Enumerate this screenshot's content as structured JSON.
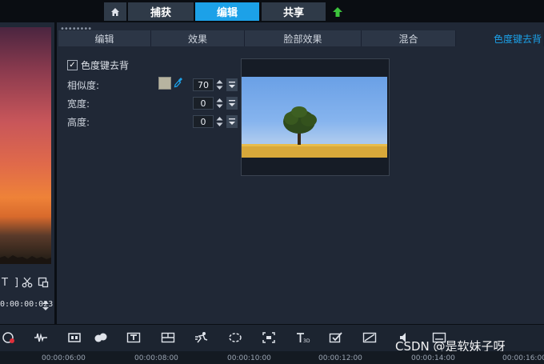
{
  "nav": {
    "home_icon": "home-icon",
    "tabs": [
      {
        "label": "捕获",
        "active": false
      },
      {
        "label": "编辑",
        "active": true
      },
      {
        "label": "共享",
        "active": false
      }
    ],
    "upload_icon": "upload-arrow-icon"
  },
  "preview": {
    "timecode": "0:00:00:023"
  },
  "options": {
    "tabs": [
      {
        "label": "编辑",
        "active": false
      },
      {
        "label": "效果",
        "active": false
      },
      {
        "label": "脸部效果",
        "active": false
      },
      {
        "label": "混合",
        "active": false
      },
      {
        "label": "色度键去背",
        "active": true
      }
    ],
    "chroma_key": {
      "label": "色度键去背",
      "checked": true
    },
    "similarity": {
      "label": "相似度:",
      "value": "70",
      "color": "#b7b4a0"
    },
    "width": {
      "label": "宽度:",
      "value": "0"
    },
    "height": {
      "label": "高度:",
      "value": "0"
    }
  },
  "timeline": {
    "ticks": [
      "00:00:06:00",
      "00:00:08:00",
      "00:00:10:00",
      "00:00:12:00",
      "00:00:14:00",
      "00:00:16:00"
    ]
  },
  "watermark": "CSDN @是软妹子呀",
  "colors": {
    "accent": "#1ca1e8",
    "panel": "#202836",
    "tab": "#2c3646"
  }
}
